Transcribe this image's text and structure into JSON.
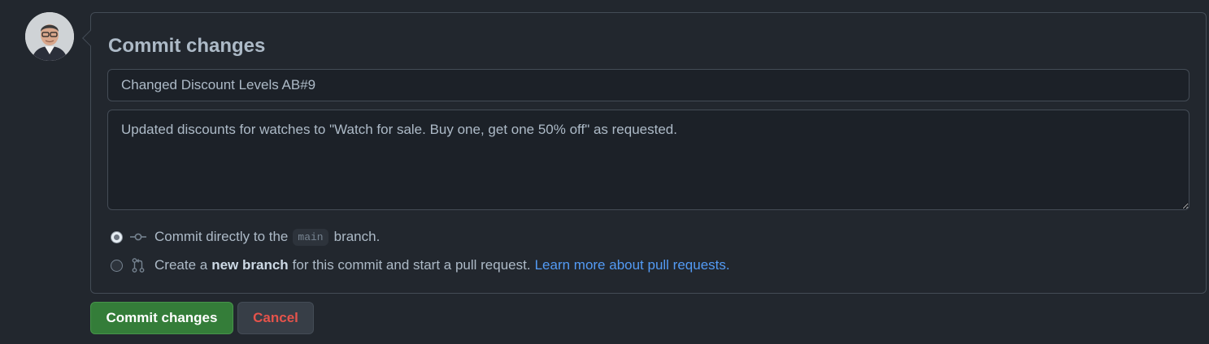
{
  "commit_form": {
    "title": "Commit changes",
    "summary_value": "Changed Discount Levels AB#9",
    "description_value": "Updated discounts for watches to \"Watch for sale. Buy one, get one 50% off\" as requested.",
    "option_direct": {
      "text_before": "Commit directly to the",
      "branch_name": "main",
      "text_after": "branch.",
      "selected": true
    },
    "option_new_branch": {
      "text_before": "Create a",
      "bold_text": "new branch",
      "text_after": "for this commit and start a pull request.",
      "link_text": "Learn more about pull requests.",
      "selected": false
    }
  },
  "buttons": {
    "commit_label": "Commit changes",
    "cancel_label": "Cancel"
  },
  "icons": {
    "avatar": "user-avatar",
    "commit": "git-commit-icon",
    "pull_request": "git-pull-request-icon"
  },
  "colors": {
    "background": "#22272e",
    "border": "#444c56",
    "text": "#adbac7",
    "link": "#539bf5",
    "commit_button": "#347d39",
    "cancel_text": "#e5534b"
  }
}
